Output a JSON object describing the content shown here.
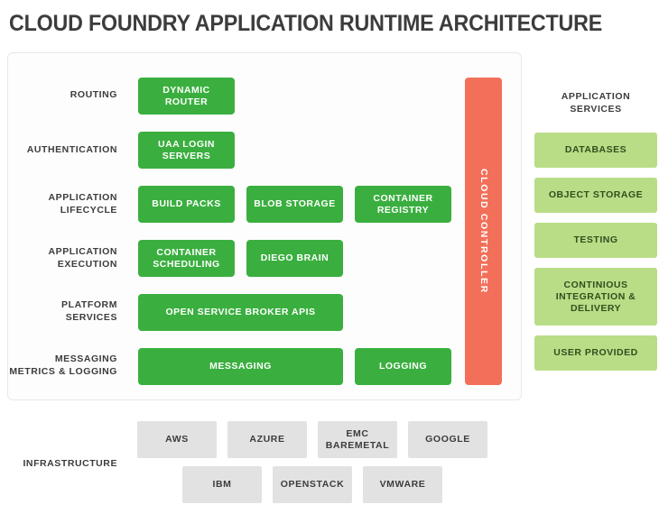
{
  "title": "Cloud Foundry Application Runtime Architecture",
  "colors": {
    "green": "#3aaf3f",
    "orange": "#f2705a",
    "light_green": "#b9dd86",
    "gray": "#e2e2e2",
    "text_dark": "#3c3c3c",
    "card_background": "#fdfdfd",
    "page_background": "#ffffff"
  },
  "rows": [
    {
      "label": "Routing",
      "boxes": [
        {
          "label": "Dynamic Router"
        }
      ]
    },
    {
      "label": "Authentication",
      "boxes": [
        {
          "label": "UAA Login Servers"
        }
      ]
    },
    {
      "label": "Application Lifecycle",
      "boxes": [
        {
          "label": "Build Packs"
        },
        {
          "label": "Blob Storage"
        },
        {
          "label": "Container Registry"
        }
      ]
    },
    {
      "label": "Application Execution",
      "boxes": [
        {
          "label": "Container Scheduling"
        },
        {
          "label": "Diego Brain"
        }
      ]
    },
    {
      "label": "Platform Services",
      "boxes": [
        {
          "label": "Open Service Broker APIs"
        }
      ]
    },
    {
      "label": "Messaging Metrics & Logging",
      "boxes": [
        {
          "label": "Messaging"
        },
        {
          "label": "Logging"
        }
      ]
    }
  ],
  "cloud_controller": {
    "label": "Cloud Controller"
  },
  "application_services": {
    "header": "Application Services",
    "items": [
      {
        "label": "Databases"
      },
      {
        "label": "Object Storage"
      },
      {
        "label": "Testing"
      },
      {
        "label": "Continious Integration & Delivery"
      },
      {
        "label": "User Provided"
      }
    ]
  },
  "infrastructure": {
    "label": "Infrastructure",
    "row1": [
      {
        "label": "AWS"
      },
      {
        "label": "Azure"
      },
      {
        "label": "EMC Baremetal"
      },
      {
        "label": "Google"
      }
    ],
    "row2": [
      {
        "label": "IBM"
      },
      {
        "label": "OpenStack"
      },
      {
        "label": "VMware"
      }
    ]
  }
}
